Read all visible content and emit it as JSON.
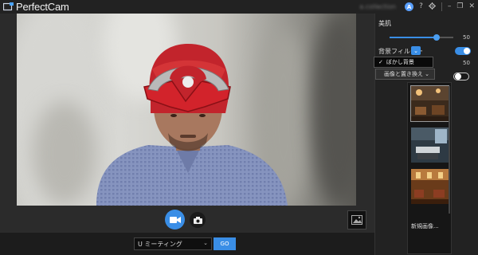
{
  "app": {
    "title": "PerfectCam",
    "account": "a.collection"
  },
  "titlebar": {
    "badge": "A",
    "help": "?",
    "settings_icon": "gear-icon",
    "minimize": "–",
    "restore": "❐",
    "close": "✕"
  },
  "panel": {
    "beauty_label": "美肌",
    "beauty_value": "50",
    "beauty_level": 50,
    "bg_filter_label": "背景フィルター",
    "bg_filter_on": true,
    "dropdown_option": "ぼかし背景",
    "blur_value": "50",
    "replace_label": "画像と置き換え",
    "replace_on": false,
    "new_image_label": "新規画像..."
  },
  "controls": {
    "video_icon": "video-camera-icon",
    "photo_icon": "camera-icon",
    "gallery_icon": "image-gallery-icon"
  },
  "bottom": {
    "meeting_select": "U ミーティング",
    "go_label": "GO"
  },
  "colors": {
    "accent": "#3a8ee6",
    "bg": "#1b1b1b",
    "panel": "#222222"
  }
}
